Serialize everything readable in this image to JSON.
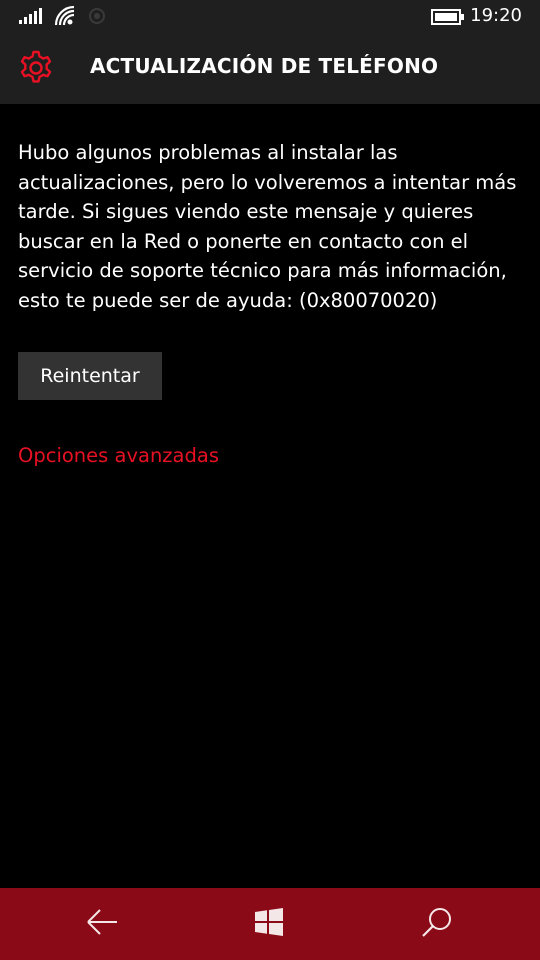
{
  "status_bar": {
    "time": "19:20",
    "icons": [
      "signal-strength-icon",
      "wifi-icon",
      "location-icon",
      "battery-icon"
    ]
  },
  "header": {
    "title": "ACTUALIZACIÓN DE TELÉFONO",
    "icon": "gear-icon"
  },
  "content": {
    "message": "Hubo algunos problemas al instalar las actualizaciones, pero lo volveremos a intentar más tarde. Si sigues viendo este mensaje y quieres buscar en la Red o ponerte en contacto con el servicio de soporte técnico para más información, esto te puede ser de ayuda: (0x80070020)",
    "retry_label": "Reintentar",
    "advanced_link": "Opciones avanzadas"
  },
  "nav_bar": {
    "buttons": [
      "back-arrow-icon",
      "windows-start-icon",
      "search-icon"
    ]
  },
  "colors": {
    "accent": "#e81123",
    "nav_bar": "#8b0a17",
    "header_bg": "#1f1f1f",
    "button_bg": "#333333",
    "background": "#000000"
  }
}
